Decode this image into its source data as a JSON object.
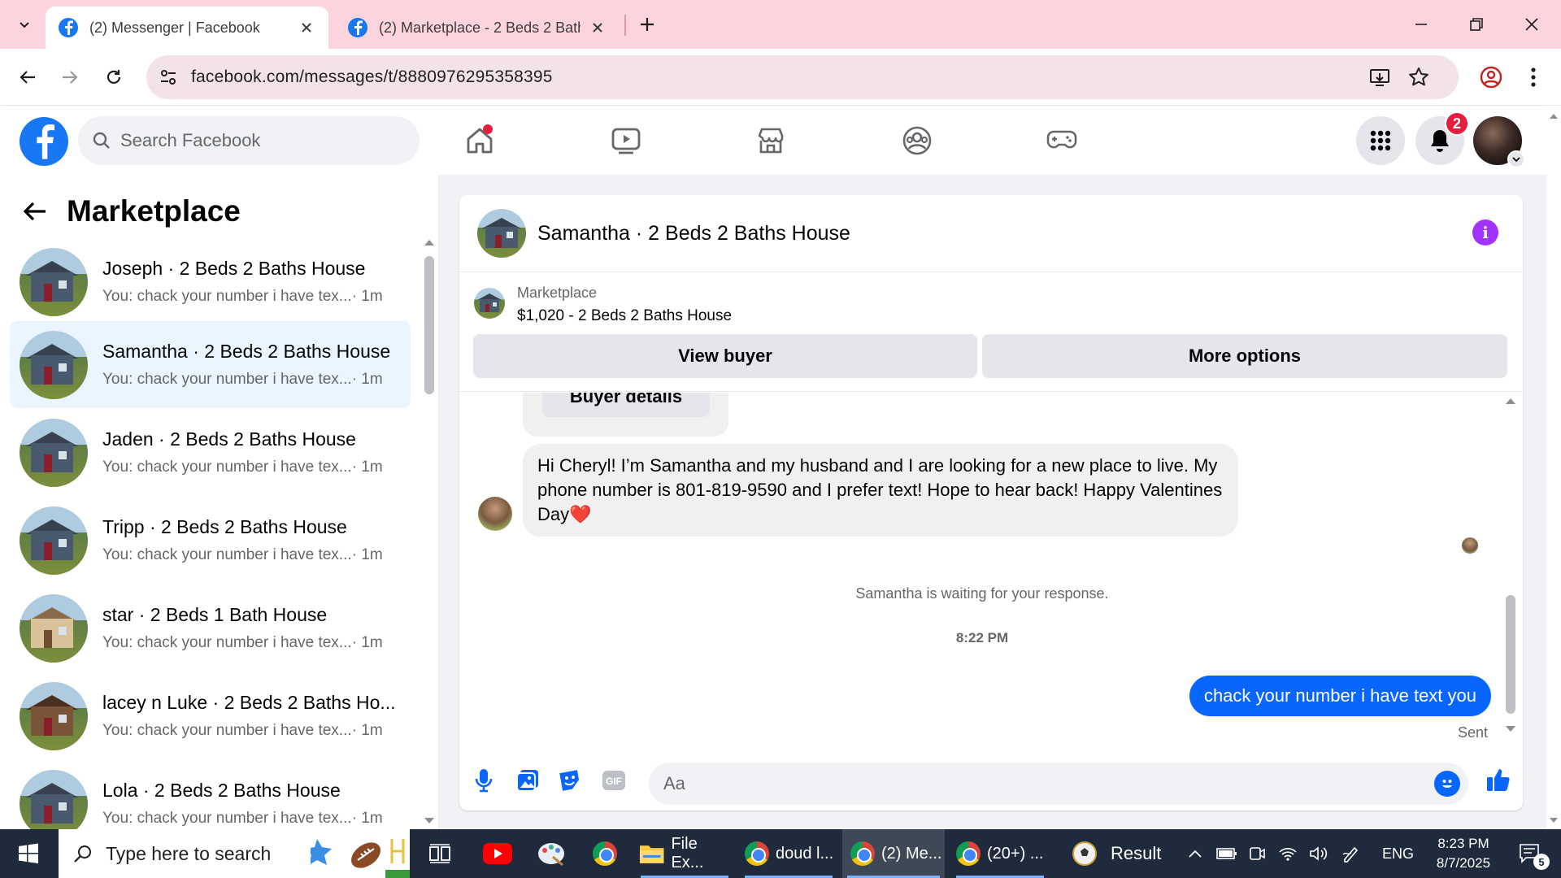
{
  "browser": {
    "tabs": [
      {
        "title": "(2) Messenger | Facebook",
        "active": true
      },
      {
        "title": "(2) Marketplace - 2 Beds 2 Baths",
        "active": false
      }
    ],
    "url": "facebook.com/messages/t/8880976295358395"
  },
  "fb_header": {
    "search_placeholder": "Search Facebook",
    "notification_count": "2",
    "nav_icons": [
      "home-icon",
      "video-icon",
      "marketplace-icon",
      "groups-icon",
      "gaming-icon"
    ]
  },
  "sidebar": {
    "title": "Marketplace",
    "conversations": [
      {
        "name": "Joseph · 2 Beds 2 Baths House",
        "preview": "You: chack your number i have tex...",
        "time": "· 1m"
      },
      {
        "name": "Samantha · 2 Beds 2 Baths House",
        "preview": "You: chack your number i have tex...",
        "time": "· 1m",
        "selected": true
      },
      {
        "name": "Jaden · 2 Beds 2 Baths House",
        "preview": "You: chack your number i have tex...",
        "time": "· 1m"
      },
      {
        "name": "Tripp · 2 Beds 2 Baths House",
        "preview": "You: chack your number i have tex...",
        "time": "· 1m"
      },
      {
        "name": "star · 2 Beds 1 Bath House",
        "preview": "You: chack your number i have tex...",
        "time": "· 1m"
      },
      {
        "name": "lacey n Luke · 2 Beds 2 Baths Ho...",
        "preview": "You: chack your number i have tex...",
        "time": "· 1m"
      },
      {
        "name": "Lola · 2 Beds 2 Baths House",
        "preview": "You: chack your number i have tex...",
        "time": "· 1m"
      }
    ]
  },
  "chat": {
    "title": "Samantha · 2 Beds 2 Baths House",
    "listing_category": "Marketplace",
    "listing_title": "$1,020 - 2 Beds 2 Baths House",
    "view_buyer_label": "View buyer",
    "more_options_label": "More options",
    "buyer_details_label": "Buyer details",
    "received_message": "Hi Cheryl! I’m Samantha and my husband and I are looking for a new place to live. My phone number is 801-819-9590 and I prefer text! Hope to hear back! Happy Valentines Day❤️",
    "waiting_text": "Samantha is waiting for your response.",
    "timestamp": "8:22 PM",
    "sent_message": "chack your number i have text you",
    "sent_status": "Sent",
    "composer_placeholder": "Aa",
    "gif_label": "GIF"
  },
  "taskbar": {
    "search_placeholder": "Type here to search",
    "apps": [
      {
        "label": "File Ex..."
      },
      {
        "label": "doud l..."
      },
      {
        "label": "(2) Me..."
      },
      {
        "label": "(20+) ..."
      },
      {
        "label": "Result"
      }
    ],
    "language": "ENG",
    "time": "8:23 PM",
    "date": "8/7/2025",
    "notifications": "5"
  },
  "colors": {
    "facebook_blue": "#1877f2",
    "messenger_blue": "#0866ff",
    "tab_strip_pink": "#fcd4de",
    "selected_conversation": "#ebf5ff",
    "badge_red": "#e41e3f",
    "info_purple": "#a033ff"
  }
}
